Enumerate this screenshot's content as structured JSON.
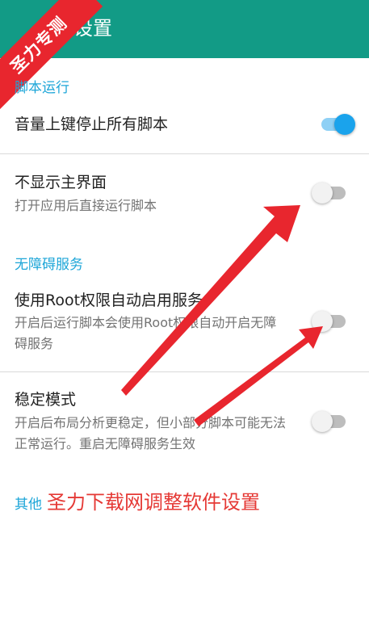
{
  "appbar": {
    "title": "设置"
  },
  "watermark": {
    "text": "圣力专测"
  },
  "sections": {
    "script_run": {
      "header": "脚本运行"
    },
    "accessibility": {
      "header": "无障碍服务"
    },
    "other": {
      "header": "其他"
    }
  },
  "settings": {
    "volume_stop": {
      "title": "音量上键停止所有脚本",
      "enabled": true
    },
    "hide_main": {
      "title": "不显示主界面",
      "summary": "打开应用后直接运行脚本",
      "enabled": false
    },
    "root_service": {
      "title": "使用Root权限自动启用服务",
      "summary": "开启后运行脚本会使用Root权限自动开启无障碍服务",
      "enabled": false
    },
    "stable_mode": {
      "title": "稳定模式",
      "summary": "开启后布局分析更稳定，但小部分脚本可能无法正常运行。重启无障碍服务生效",
      "enabled": false
    }
  },
  "promo": {
    "text": "圣力下载网调整软件设置"
  },
  "colors": {
    "appbar": "#129b86",
    "accent": "#1ea6d8",
    "switch_on": "#1aa3ec",
    "arrow": "#e8262e"
  }
}
